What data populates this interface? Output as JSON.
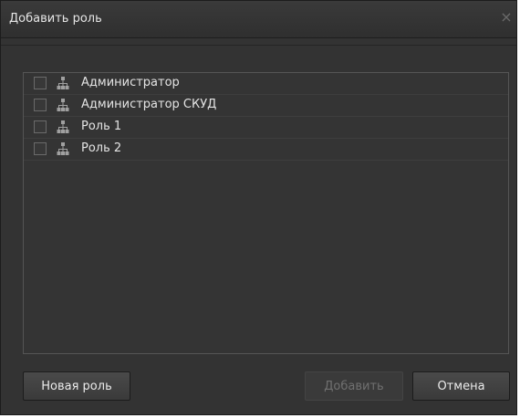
{
  "dialog": {
    "title": "Добавить роль",
    "close_icon": "×"
  },
  "roles": [
    {
      "label": "Администратор",
      "checked": false,
      "icon": "role-tree-icon"
    },
    {
      "label": "Администратор СКУД",
      "checked": false,
      "icon": "role-tree-icon"
    },
    {
      "label": "Роль 1",
      "checked": false,
      "icon": "role-tree-icon"
    },
    {
      "label": "Роль 2",
      "checked": false,
      "icon": "role-tree-icon"
    }
  ],
  "buttons": {
    "new_role": "Новая роль",
    "add": "Добавить",
    "cancel": "Отмена"
  },
  "colors": {
    "background": "#333333",
    "text": "#e4e4e4",
    "disabled_text": "#707070",
    "icon": "#a0a0a0"
  }
}
